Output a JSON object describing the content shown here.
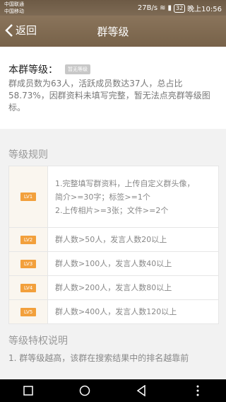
{
  "status": {
    "carrier1": "中国联通",
    "carrier2": "中国移动",
    "speed": "27B/s",
    "battery": "32",
    "time": "晚上10:56"
  },
  "nav": {
    "back_label": "返回",
    "title": "群等级"
  },
  "group": {
    "level_label": "本群等级：",
    "level_badge": "暂无等级",
    "description": "群成员数为63人，活跃成员数达37人，总占比58.73%，因群资料未填写完整，暂无法点亮群等级图标。"
  },
  "rules": {
    "title": "等级规则",
    "rows": [
      {
        "level": "LV1",
        "line1": "1.完整填写群资料，上传自定义群头像，",
        "line2": "简介>=30字；标签>=1个",
        "line3": "2.上传相片>=3张；文件>=2个"
      },
      {
        "level": "LV2",
        "text": "群人数>50人，发言人数20以上"
      },
      {
        "level": "LV3",
        "text": "群人数>100人，发言人数40以上"
      },
      {
        "level": "LV4",
        "text": "群人数>200人，发言人数80以上"
      },
      {
        "level": "LV5",
        "text": "群人数>400人，发言人数120以上"
      }
    ]
  },
  "privileges": {
    "title": "等级特权说明",
    "text": "1. 群等级越高，该群在搜索结果中的排名越靠前"
  }
}
